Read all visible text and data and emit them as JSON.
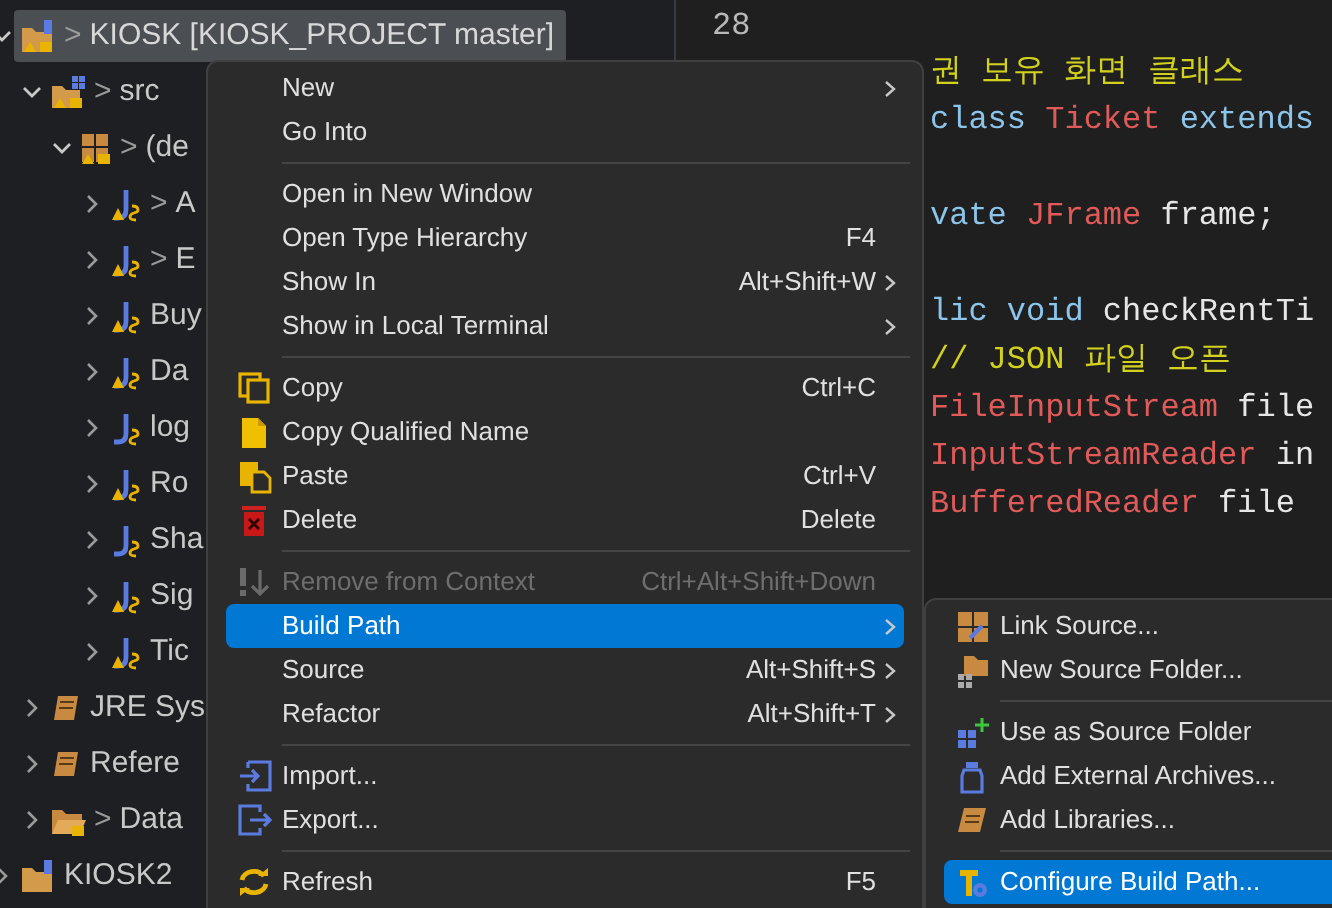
{
  "project_tree": {
    "items": [
      {
        "kind": "project",
        "prefix": ">",
        "label": "KIOSK [KIOSK_PROJECT master]",
        "warning": true,
        "expanded": true,
        "selected": true,
        "children": [
          {
            "kind": "source-folder",
            "prefix": ">",
            "label": "src",
            "warning": true,
            "expanded": true,
            "selected": false,
            "children": [
              {
                "kind": "package",
                "prefix": ">",
                "label": "(de",
                "warning": true,
                "expanded": true,
                "selected": false,
                "children": [
                  {
                    "kind": "class",
                    "prefix": ">",
                    "label": "A",
                    "warning": true,
                    "expanded": false,
                    "selected": false
                  },
                  {
                    "kind": "class",
                    "prefix": ">",
                    "label": "E",
                    "warning": true,
                    "expanded": false,
                    "selected": false
                  },
                  {
                    "kind": "class",
                    "label": "Buy",
                    "warning": true,
                    "expanded": false,
                    "selected": false
                  },
                  {
                    "kind": "class",
                    "label": "Da",
                    "warning": true,
                    "expanded": false,
                    "selected": false
                  },
                  {
                    "kind": "class",
                    "label": "log",
                    "warning": false,
                    "expanded": false,
                    "selected": false
                  },
                  {
                    "kind": "class",
                    "label": "Ro",
                    "warning": true,
                    "expanded": false,
                    "selected": false
                  },
                  {
                    "kind": "class",
                    "label": "Sha",
                    "warning": false,
                    "expanded": false,
                    "selected": false
                  },
                  {
                    "kind": "class",
                    "label": "Sig",
                    "warning": true,
                    "expanded": false,
                    "selected": false
                  },
                  {
                    "kind": "class",
                    "label": "Tic",
                    "warning": true,
                    "expanded": false,
                    "selected": false
                  }
                ]
              }
            ]
          },
          {
            "kind": "library",
            "label": "JRE Sys",
            "warning": false,
            "expanded": false,
            "selected": false
          },
          {
            "kind": "library",
            "label": "Refere",
            "warning": false,
            "expanded": false,
            "selected": false
          },
          {
            "kind": "folder",
            "prefix": ">",
            "label": "Data",
            "warning": true,
            "expanded": false,
            "selected": false
          }
        ]
      },
      {
        "kind": "project",
        "label": "KIOSK2",
        "warning": false,
        "expanded": false,
        "selected": false
      }
    ]
  },
  "editor": {
    "line_number": "28",
    "lines": [
      {
        "kind": "code",
        "segments": [
          {
            "kind": "comment",
            "text": "권 보유 화면 클래스"
          }
        ]
      },
      {
        "kind": "code",
        "segments": [
          {
            "kind": "keyword",
            "text": "class "
          },
          {
            "kind": "type",
            "text": "Ticket"
          },
          {
            "kind": "keyword",
            "text": " extends"
          }
        ]
      },
      {
        "kind": "blank"
      },
      {
        "kind": "code",
        "segments": [
          {
            "kind": "keyword",
            "text": "vate "
          },
          {
            "kind": "type",
            "text": "JFrame"
          },
          {
            "kind": "plain",
            "text": " frame;"
          }
        ]
      },
      {
        "kind": "blank"
      },
      {
        "kind": "code",
        "segments": [
          {
            "kind": "keyword",
            "text": "lic void "
          },
          {
            "kind": "plain",
            "text": "checkRentTi"
          }
        ]
      },
      {
        "kind": "code",
        "segments": [
          {
            "kind": "comment",
            "text": "// JSON 파일 오픈"
          }
        ]
      },
      {
        "kind": "code",
        "segments": [
          {
            "kind": "type",
            "text": "FileInputStream"
          },
          {
            "kind": "plain",
            "text": " file"
          }
        ]
      },
      {
        "kind": "code",
        "segments": [
          {
            "kind": "type",
            "text": "InputStreamReader"
          },
          {
            "kind": "plain",
            "text": " in"
          }
        ]
      },
      {
        "kind": "code",
        "segments": [
          {
            "kind": "type",
            "text": "BufferedReader"
          },
          {
            "kind": "plain",
            "text": " file"
          }
        ]
      }
    ]
  },
  "context_menu": {
    "items": [
      {
        "kind": "item",
        "label": "New",
        "submenu": true,
        "disabled": false,
        "selected": false
      },
      {
        "kind": "item",
        "label": "Go Into",
        "submenu": false,
        "disabled": false,
        "selected": false
      },
      {
        "kind": "separator"
      },
      {
        "kind": "item",
        "label": "Open in New Window",
        "submenu": false,
        "disabled": false,
        "selected": false
      },
      {
        "kind": "item",
        "label": "Open Type Hierarchy",
        "shortcut": "F4",
        "submenu": false,
        "disabled": false,
        "selected": false
      },
      {
        "kind": "item",
        "label": "Show In",
        "shortcut": "Alt+Shift+W",
        "submenu": true,
        "disabled": false,
        "selected": false
      },
      {
        "kind": "item",
        "label": "Show in Local Terminal",
        "submenu": true,
        "disabled": false,
        "selected": false
      },
      {
        "kind": "separator"
      },
      {
        "kind": "item",
        "label": "Copy",
        "shortcut": "Ctrl+C",
        "submenu": false,
        "disabled": false,
        "selected": false
      },
      {
        "kind": "item",
        "label": "Copy Qualified Name",
        "submenu": false,
        "disabled": false,
        "selected": false
      },
      {
        "kind": "item",
        "label": "Paste",
        "shortcut": "Ctrl+V",
        "submenu": false,
        "disabled": false,
        "selected": false
      },
      {
        "kind": "item",
        "label": "Delete",
        "shortcut": "Delete",
        "submenu": false,
        "disabled": false,
        "selected": false
      },
      {
        "kind": "separator"
      },
      {
        "kind": "item",
        "label": "Remove from Context",
        "shortcut": "Ctrl+Alt+Shift+Down",
        "submenu": false,
        "disabled": true,
        "selected": false
      },
      {
        "kind": "item",
        "label": "Build Path",
        "submenu": true,
        "disabled": false,
        "selected": true
      },
      {
        "kind": "item",
        "label": "Source",
        "shortcut": "Alt+Shift+S",
        "submenu": true,
        "disabled": false,
        "selected": false
      },
      {
        "kind": "item",
        "label": "Refactor",
        "shortcut": "Alt+Shift+T",
        "submenu": true,
        "disabled": false,
        "selected": false
      },
      {
        "kind": "separator"
      },
      {
        "kind": "item",
        "label": "Import...",
        "submenu": false,
        "disabled": false,
        "selected": false
      },
      {
        "kind": "item",
        "label": "Export...",
        "submenu": false,
        "disabled": false,
        "selected": false
      },
      {
        "kind": "separator"
      },
      {
        "kind": "item",
        "label": "Refresh",
        "shortcut": "F5",
        "submenu": false,
        "disabled": false,
        "selected": false
      }
    ]
  },
  "build_path_submenu": {
    "items": [
      {
        "kind": "item",
        "label": "Link Source...",
        "disabled": false,
        "selected": false
      },
      {
        "kind": "item",
        "label": "New Source Folder...",
        "disabled": false,
        "selected": false
      },
      {
        "kind": "separator"
      },
      {
        "kind": "item",
        "label": "Use as Source Folder",
        "disabled": false,
        "selected": false
      },
      {
        "kind": "item",
        "label": "Add External Archives...",
        "disabled": false,
        "selected": false
      },
      {
        "kind": "item",
        "label": "Add Libraries...",
        "disabled": false,
        "selected": false
      },
      {
        "kind": "separator"
      },
      {
        "kind": "item",
        "label": "Configure Build Path...",
        "disabled": false,
        "selected": true
      }
    ]
  }
}
